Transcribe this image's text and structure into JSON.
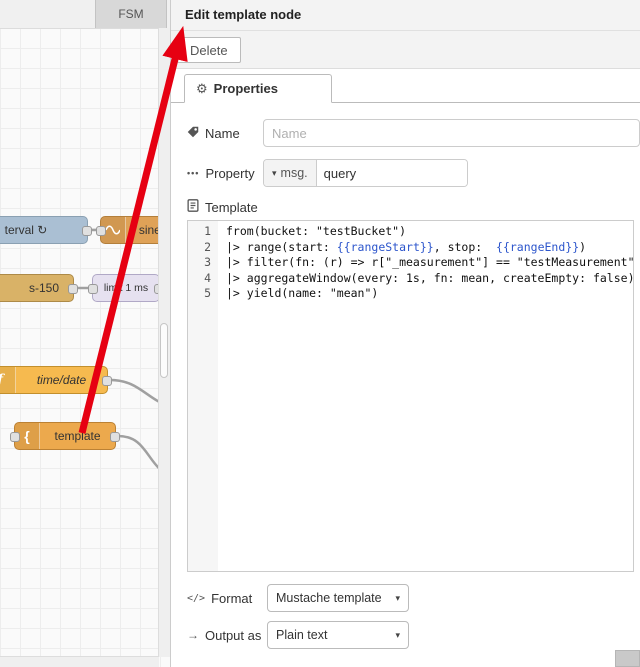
{
  "canvas": {
    "tab_label": "FSM",
    "wire_color": "#a0a0a0",
    "icons": {
      "function_f": "f",
      "mustache_brace": "{"
    },
    "nodes": [
      {
        "label": "terval ↻",
        "color": {
          "bg": "#aabfd3",
          "border": "#8aa0b2"
        }
      },
      {
        "label": "sineW",
        "color": {
          "bg": "#dfa257",
          "border": "#b37f3b"
        }
      },
      {
        "label": "s-150",
        "color": {
          "bg": "#d9b267",
          "border": "#ad8a47"
        }
      },
      {
        "label": "limit 1 ms",
        "color": {
          "bg": "#e6e1f0",
          "border": "#b0a8c6"
        }
      },
      {
        "label": "time/date",
        "color": {
          "bg": "#f6ba4f",
          "border": "#c28f2c"
        }
      },
      {
        "label": "template",
        "color": {
          "bg": "#eca94d",
          "border": "#bb8134"
        }
      }
    ]
  },
  "panel": {
    "title": "Edit template node",
    "delete_button": "Delete",
    "properties_tab": "Properties",
    "icons": {
      "gear": "⚙",
      "ellipsis": "•••",
      "format": "</>",
      "output": "→",
      "caret": "▾"
    },
    "name": {
      "label": "Name",
      "placeholder": "Name"
    },
    "property": {
      "label": "Property",
      "type": "msg.",
      "value": "query"
    },
    "template": {
      "label": "Template",
      "lines": [
        "from(bucket: \"testBucket\")",
        "|> range(start: {{rangeStart}}, stop:  {{rangeEnd}})",
        "|> filter(fn: (r) => r[\"_measurement\"] == \"testMeasurement\")",
        "|> aggregateWindow(every: 1s, fn: mean, createEmpty: false)",
        "|> yield(name: \"mean\")"
      ]
    },
    "format": {
      "label": "Format",
      "value": "Mustache template"
    },
    "output": {
      "label": "Output as",
      "value": "Plain text"
    },
    "colors": {
      "mustache_token": "#2d56cc"
    }
  },
  "annotation": {
    "arrow_color": "#e60012"
  }
}
